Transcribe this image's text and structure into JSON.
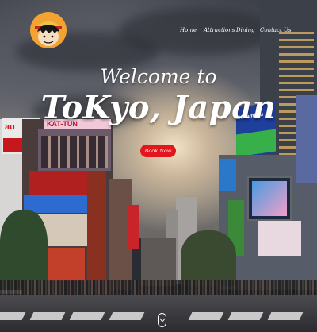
{
  "header": {
    "logo_icon": "straw-hat-luffy-logo-icon",
    "nav": [
      {
        "label": "Home"
      },
      {
        "label": "Attractions"
      },
      {
        "label": "Dining"
      },
      {
        "label": "Contact Us"
      }
    ]
  },
  "hero": {
    "welcome": "Welcome to",
    "title": "ToKyo, Japan",
    "cta_label": "Book Now",
    "scroll_icon": "chevron-down-icon"
  },
  "background_signs": {
    "left_top": "au",
    "left_brand": "KAT-TUN",
    "right_top": "Hisamitsu"
  },
  "colors": {
    "cta": "#e4151b",
    "logo_bg": "#f2a331",
    "text": "#ffffff"
  }
}
